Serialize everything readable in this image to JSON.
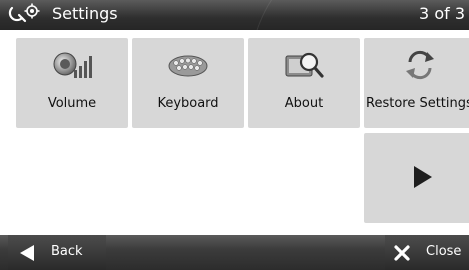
{
  "titlebar": {
    "title": "Settings",
    "page_indicator": "3 of 3"
  },
  "tiles": [
    {
      "label": "Volume",
      "icon": "speaker-volume-icon"
    },
    {
      "label": "Keyboard",
      "icon": "keyboard-icon"
    },
    {
      "label": "About",
      "icon": "about-magnifier-icon"
    },
    {
      "label": "Restore Settings",
      "icon": "restore-arrows-icon"
    },
    {
      "label": "",
      "icon": "next-arrow-icon"
    }
  ],
  "bottombar": {
    "back_label": "Back",
    "close_label": "Close"
  },
  "colors": {
    "tile_bg": "#d7d7d7",
    "bar_dark": "#2e2e2e",
    "page_bg": "#ffffff"
  }
}
